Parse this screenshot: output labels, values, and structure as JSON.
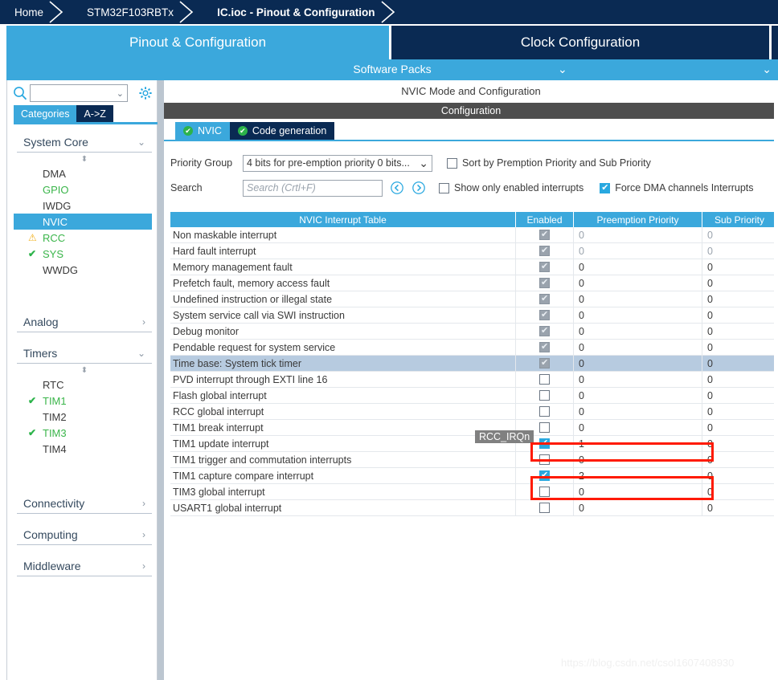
{
  "breadcrumb": {
    "items": [
      {
        "label": "Home",
        "active": false
      },
      {
        "label": "STM32F103RBTx",
        "active": false
      },
      {
        "label": "IC.ioc - Pinout & Configuration",
        "active": true
      }
    ]
  },
  "tabs": {
    "pinout": "Pinout & Configuration",
    "clock": "Clock Configuration"
  },
  "software_packs": {
    "label": "Software Packs",
    "chevron_left": "chevron-down-icon",
    "chevron_right": "chevron-down-icon"
  },
  "sidebar": {
    "search": {
      "value": "",
      "placeholder": ""
    },
    "category_tabs": [
      {
        "label": "Categories",
        "selected": true
      },
      {
        "label": "A->Z",
        "selected": false
      }
    ],
    "groups": [
      {
        "name": "System Core",
        "expanded": true,
        "items": [
          {
            "label": "DMA",
            "state": "none"
          },
          {
            "label": "GPIO",
            "state": "configured"
          },
          {
            "label": "IWDG",
            "state": "none"
          },
          {
            "label": "NVIC",
            "state": "selected"
          },
          {
            "label": "RCC",
            "state": "warning"
          },
          {
            "label": "SYS",
            "state": "ok"
          },
          {
            "label": "WWDG",
            "state": "none"
          }
        ]
      },
      {
        "name": "Analog",
        "expanded": false,
        "items": []
      },
      {
        "name": "Timers",
        "expanded": true,
        "items": [
          {
            "label": "RTC",
            "state": "none"
          },
          {
            "label": "TIM1",
            "state": "ok"
          },
          {
            "label": "TIM2",
            "state": "none"
          },
          {
            "label": "TIM3",
            "state": "ok"
          },
          {
            "label": "TIM4",
            "state": "none"
          }
        ]
      },
      {
        "name": "Connectivity",
        "expanded": false,
        "items": []
      },
      {
        "name": "Computing",
        "expanded": false,
        "items": []
      },
      {
        "name": "Middleware",
        "expanded": false,
        "items": []
      }
    ]
  },
  "panel": {
    "title": "NVIC Mode and Configuration",
    "configuration_bar": "Configuration",
    "subtabs": [
      {
        "label": "NVIC",
        "selected": true
      },
      {
        "label": "Code generation",
        "selected": false
      }
    ],
    "priority_group": {
      "label": "Priority Group",
      "value": "4 bits for pre-emption priority 0 bits..."
    },
    "search": {
      "label": "Search",
      "value": "",
      "placeholder": "Search (Crtl+F)",
      "prev_icon": "arrow-left-circle-icon",
      "next_icon": "arrow-right-circle-icon"
    },
    "options": [
      {
        "label": "Sort by Premption Priority and Sub Priority",
        "checked": false
      },
      {
        "label": "Show only enabled interrupts",
        "checked": false
      },
      {
        "label": "Force DMA channels Interrupts",
        "checked": true
      }
    ]
  },
  "table": {
    "columns": [
      "NVIC Interrupt Table",
      "Enabled",
      "Preemption Priority",
      "Sub Priority"
    ],
    "rows": [
      {
        "name": "Non maskable interrupt",
        "enabled": "locked",
        "preemption": "0",
        "sub": "0",
        "muted": true,
        "highlight": false
      },
      {
        "name": "Hard fault interrupt",
        "enabled": "locked",
        "preemption": "0",
        "sub": "0",
        "muted": true,
        "highlight": false
      },
      {
        "name": "Memory management fault",
        "enabled": "locked",
        "preemption": "0",
        "sub": "0",
        "muted": false,
        "highlight": false
      },
      {
        "name": "Prefetch fault, memory access fault",
        "enabled": "locked",
        "preemption": "0",
        "sub": "0",
        "muted": false,
        "highlight": false
      },
      {
        "name": "Undefined instruction or illegal state",
        "enabled": "locked",
        "preemption": "0",
        "sub": "0",
        "muted": false,
        "highlight": false
      },
      {
        "name": "System service call via SWI instruction",
        "enabled": "locked",
        "preemption": "0",
        "sub": "0",
        "muted": false,
        "highlight": false
      },
      {
        "name": "Debug monitor",
        "enabled": "locked",
        "preemption": "0",
        "sub": "0",
        "muted": false,
        "highlight": false
      },
      {
        "name": "Pendable request for system service",
        "enabled": "locked",
        "preemption": "0",
        "sub": "0",
        "muted": false,
        "highlight": false
      },
      {
        "name": "Time base: System tick timer",
        "enabled": "locked",
        "preemption": "0",
        "sub": "0",
        "muted": false,
        "highlight": true
      },
      {
        "name": "PVD interrupt through EXTI line 16",
        "enabled": "off",
        "preemption": "0",
        "sub": "0",
        "muted": false,
        "highlight": false
      },
      {
        "name": "Flash global interrupt",
        "enabled": "off",
        "preemption": "0",
        "sub": "0",
        "muted": false,
        "highlight": false
      },
      {
        "name": "RCC global interrupt",
        "enabled": "off",
        "preemption": "0",
        "sub": "0",
        "muted": false,
        "highlight": false
      },
      {
        "name": "TIM1 break interrupt",
        "enabled": "off",
        "preemption": "0",
        "sub": "0",
        "muted": false,
        "highlight": false
      },
      {
        "name": "TIM1 update interrupt",
        "enabled": "on",
        "preemption": "1",
        "sub": "0",
        "muted": false,
        "highlight": false
      },
      {
        "name": "TIM1 trigger and commutation interrupts",
        "enabled": "off",
        "preemption": "0",
        "sub": "0",
        "muted": false,
        "highlight": false
      },
      {
        "name": "TIM1 capture compare interrupt",
        "enabled": "on",
        "preemption": "2",
        "sub": "0",
        "muted": false,
        "highlight": false
      },
      {
        "name": "TIM3 global interrupt",
        "enabled": "off",
        "preemption": "0",
        "sub": "0",
        "muted": false,
        "highlight": false
      },
      {
        "name": "USART1 global interrupt",
        "enabled": "off",
        "preemption": "0",
        "sub": "0",
        "muted": false,
        "highlight": false
      }
    ]
  },
  "overlays": {
    "tooltip": "RCC_IRQn",
    "annotation_color": "#ff1a00",
    "watermark": "https://blog.csdn.net/csol1607408930"
  }
}
